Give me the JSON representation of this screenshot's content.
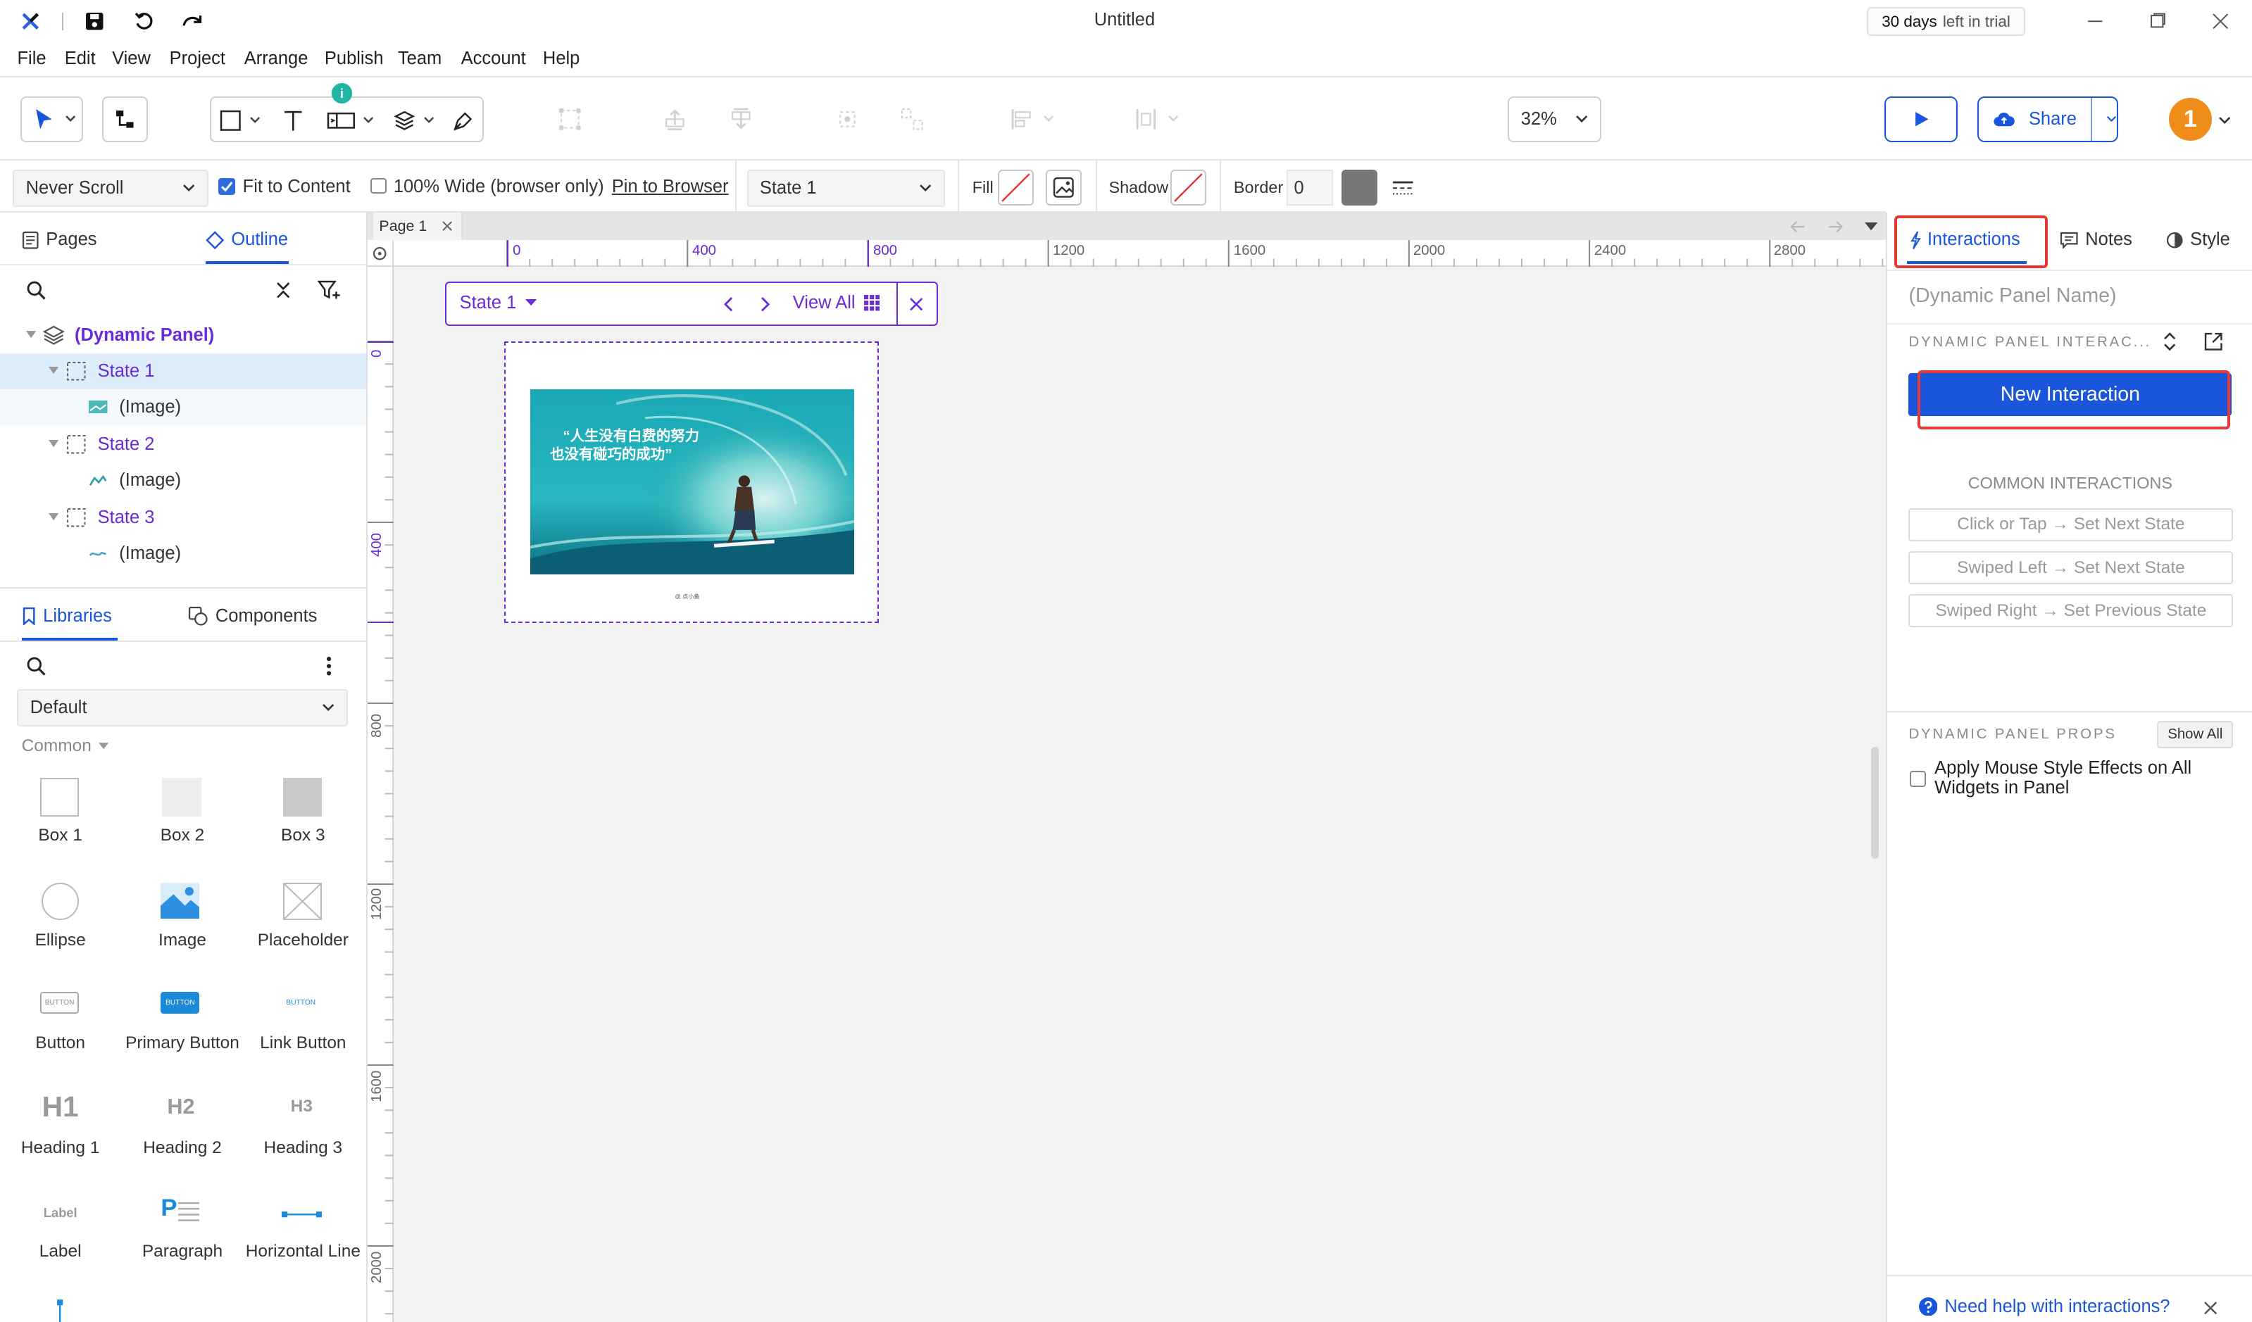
{
  "window": {
    "title": "Untitled",
    "trial_days": "30 days",
    "trial_suffix": "left in trial"
  },
  "menu": [
    "File",
    "Edit",
    "View",
    "Project",
    "Arrange",
    "Publish",
    "Team",
    "Account",
    "Help"
  ],
  "toolbar": {
    "badge": "i",
    "zoom": "32%",
    "share_label": "Share",
    "avatar_initial": "1"
  },
  "propbar": {
    "scroll": "Never Scroll",
    "fit_to_content": "Fit to Content",
    "wide": "100% Wide (browser only)",
    "pin": "Pin to Browser",
    "state": "State 1",
    "fill": "Fill",
    "shadow": "Shadow",
    "border": "Border",
    "border_value": "0"
  },
  "left": {
    "tabs": {
      "pages": "Pages",
      "outline": "Outline"
    },
    "tree": [
      {
        "label": "(Dynamic Panel)",
        "level": 0
      },
      {
        "label": "State 1",
        "level": 1
      },
      {
        "label": "(Image)",
        "level": 2
      },
      {
        "label": "State 2",
        "level": 1
      },
      {
        "label": "(Image)",
        "level": 2
      },
      {
        "label": "State 3",
        "level": 1
      },
      {
        "label": "(Image)",
        "level": 2
      }
    ],
    "lib_tabs": {
      "libraries": "Libraries",
      "components": "Components"
    },
    "library": "Default",
    "category": "Common",
    "widgets": [
      "Box 1",
      "Box 2",
      "Box 3",
      "Ellipse",
      "Image",
      "Placeholder",
      "Button",
      "Primary Button",
      "Link Button",
      "Heading 1",
      "Heading 2",
      "Heading 3",
      "Label",
      "Paragraph",
      "Horizontal Line"
    ],
    "widget_glyphs": {
      "button": "BUTTON",
      "h1": "H1",
      "h2": "H2",
      "h3": "H3",
      "label": "Label",
      "para": "P"
    }
  },
  "canvas": {
    "page_tab": "Page 1",
    "hruler": [
      "0",
      "400",
      "800",
      "1200",
      "1600",
      "2000",
      "2400",
      "2800"
    ],
    "vruler": [
      "0",
      "400",
      "800",
      "1200",
      "1600",
      "2000"
    ],
    "state_bar": {
      "state": "State 1",
      "view_all": "View All"
    },
    "image_text_line1": "“人生没有白费的努力",
    "image_text_line2": "也没有碰巧的成功”",
    "caption": "@ 点小鱼"
  },
  "right": {
    "tabs": {
      "interactions": "Interactions",
      "notes": "Notes",
      "style": "Style"
    },
    "panel_name": "(Dynamic Panel Name)",
    "section": "DYNAMIC PANEL INTERAC...",
    "new_interaction": "New Interaction",
    "common": "COMMON INTERACTIONS",
    "common_items": [
      "Click or Tap → Set Next State",
      "Swiped Left → Set Next State",
      "Swiped Right → Set Previous State"
    ],
    "props": "DYNAMIC PANEL PROPS",
    "show_all": "Show All",
    "mouse_effects": "Apply Mouse Style Effects on All Widgets in Panel",
    "help": "Need help with interactions?"
  },
  "colors": {
    "accent": "#1a73e8",
    "purple": "#6a2bd9",
    "highlight": "#e53935",
    "orange": "#f08c1a"
  }
}
